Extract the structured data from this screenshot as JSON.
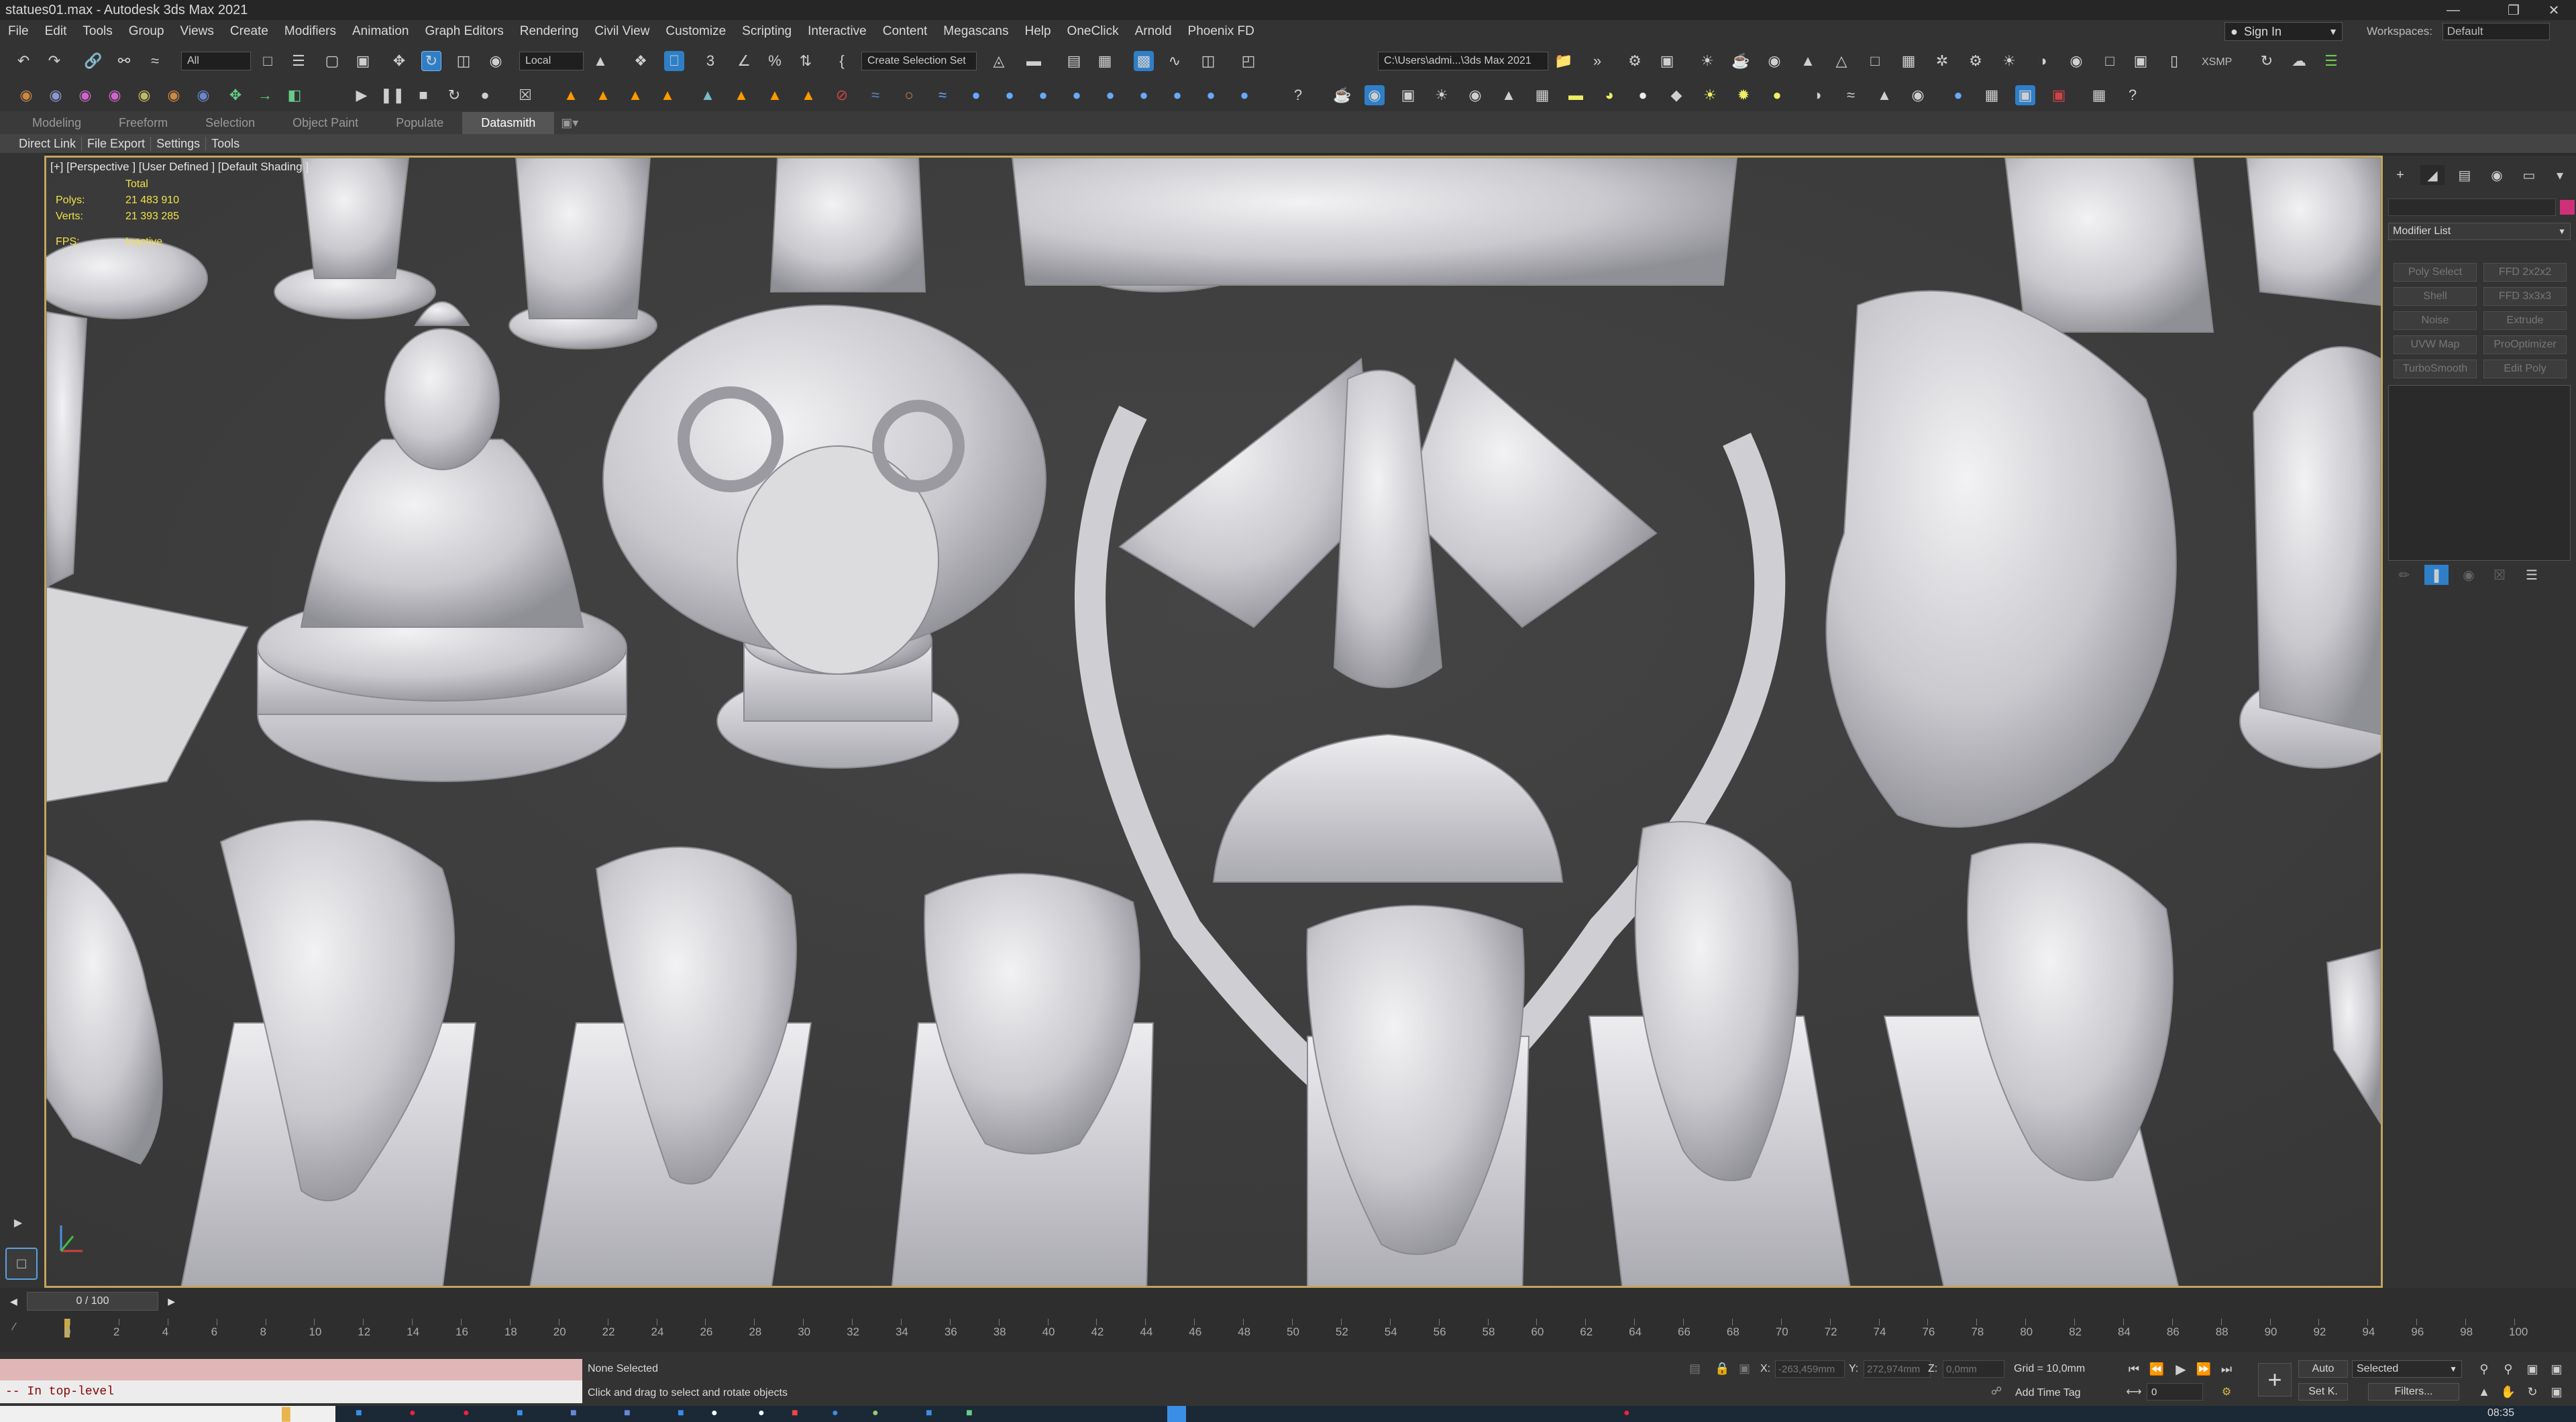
{
  "window": {
    "title": "statues01.max - Autodesk 3ds Max 2021"
  },
  "menu": [
    "File",
    "Edit",
    "Tools",
    "Group",
    "Views",
    "Create",
    "Modifiers",
    "Animation",
    "Graph Editors",
    "Rendering",
    "Civil View",
    "Customize",
    "Scripting",
    "Interactive",
    "Content",
    "Megascans",
    "Help",
    "OneClick",
    "Arnold",
    "Phoenix FD"
  ],
  "signin": {
    "label": "Sign In"
  },
  "workspaces": {
    "label": "Workspaces:",
    "value": "Default"
  },
  "toolbar": {
    "filter": "All",
    "coord_system": "Local",
    "selection_set": "Create Selection Set",
    "project_path": "C:\\Users\\admi...\\3ds Max 2021",
    "xsmp": "XSMP"
  },
  "ribbon": {
    "tabs": [
      "Modeling",
      "Freeform",
      "Selection",
      "Object Paint",
      "Populate",
      "Datasmith"
    ],
    "active": "Datasmith"
  },
  "subribbon": [
    "Direct Link",
    "File Export",
    "Settings",
    "Tools"
  ],
  "viewport": {
    "label": "[+] [Perspective ] [User Defined ] [Default Shading ]",
    "stats": [
      {
        "key": "",
        "value": "Total"
      },
      {
        "key": "Polys:",
        "value": "21 483 910"
      },
      {
        "key": "Verts:",
        "value": "21 393 285"
      },
      {
        "key": "FPS:",
        "value": "Inactive"
      }
    ]
  },
  "command_panel": {
    "modifier_list": "Modifier List",
    "buttons": [
      "Poly Select",
      "FFD 2x2x2",
      "Shell",
      "FFD 3x3x3",
      "Noise",
      "Extrude",
      "UVW Map",
      "ProOptimizer",
      "TurboSmooth",
      "Edit Poly"
    ]
  },
  "timeline": {
    "slider": "0 / 100",
    "ticks": [
      0,
      2,
      4,
      6,
      8,
      10,
      12,
      14,
      16,
      18,
      20,
      22,
      24,
      26,
      28,
      30,
      32,
      34,
      36,
      38,
      40,
      42,
      44,
      46,
      48,
      50,
      52,
      54,
      56,
      58,
      60,
      62,
      64,
      66,
      68,
      70,
      72,
      74,
      76,
      78,
      80,
      82,
      84,
      86,
      88,
      90,
      92,
      94,
      96,
      98,
      100
    ]
  },
  "status": {
    "maxscript_output": "-- In top-level",
    "selection": "None Selected",
    "prompt": "Click and drag to select and rotate objects",
    "x_label": "X:",
    "x_value": "-263,459mm",
    "y_label": "Y:",
    "y_value": "272,974mm",
    "z_label": "Z:",
    "z_value": "0,0mm",
    "grid": "Grid = 10,0mm",
    "add_time_tag": "Add Time Tag",
    "auto_key": "Auto",
    "set_key": "Set K.",
    "key_filter": "Selected",
    "filters": "Filters...",
    "frame": "0",
    "clock": "08:35"
  },
  "colors": {
    "viewport_border": "#c2a45c",
    "stats_text": "#f2e14a",
    "accent_blue": "#2f7fc8"
  }
}
